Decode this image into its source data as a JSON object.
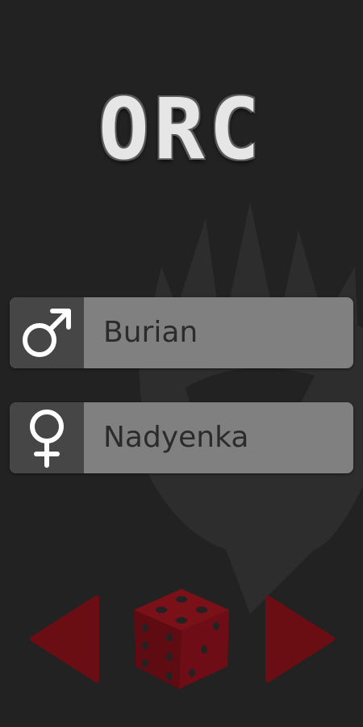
{
  "title": "ORC",
  "names": [
    {
      "gender": "male",
      "icon": "male-symbol-icon",
      "name": "Burian"
    },
    {
      "gender": "female",
      "icon": "female-symbol-icon",
      "name": "Nadyenka"
    }
  ],
  "controls": {
    "prev_icon": "left-arrow-icon",
    "dice_icon": "dice-icon",
    "next_icon": "right-arrow-icon"
  },
  "colors": {
    "background": "#222222",
    "row": "#808080",
    "icon_box": "#464646",
    "accent": "#6b0e14"
  }
}
